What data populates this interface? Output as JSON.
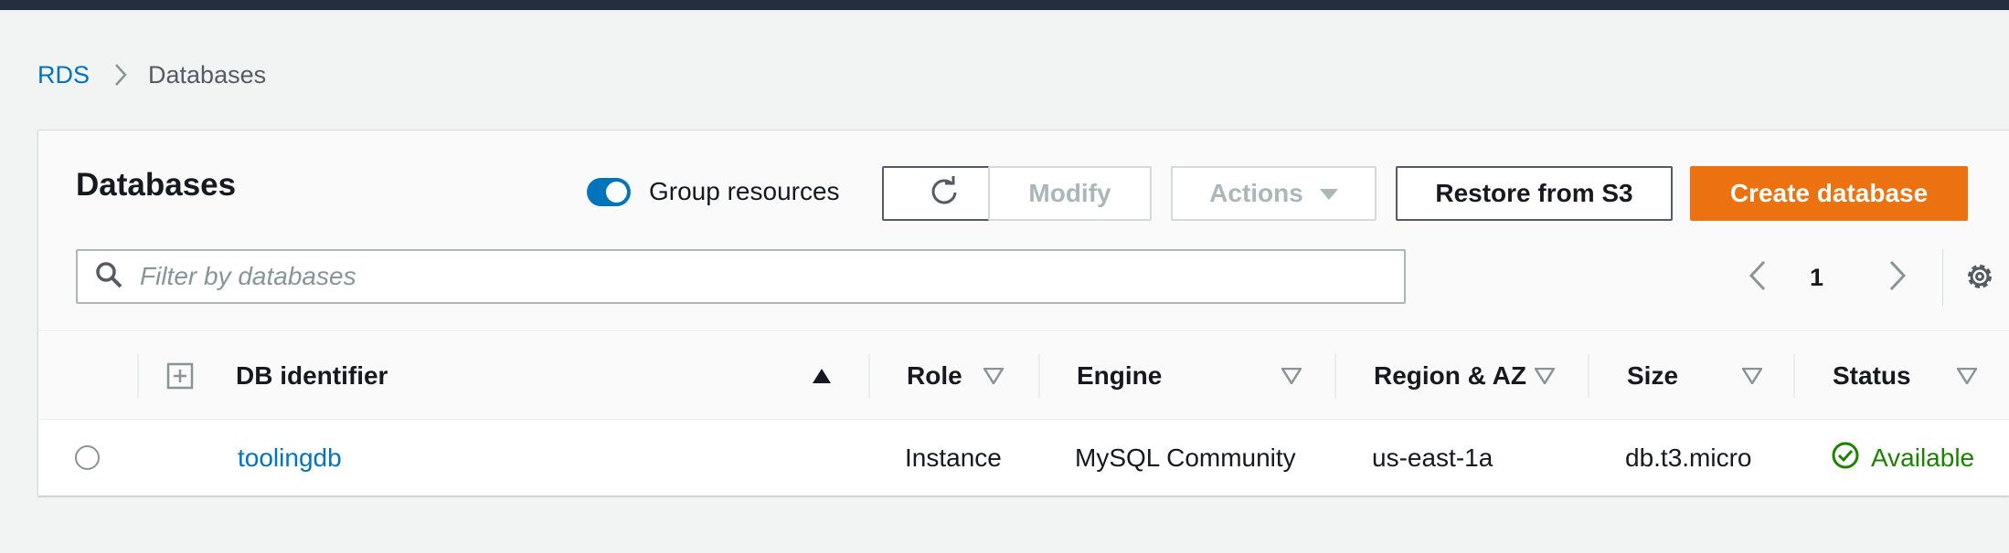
{
  "breadcrumb": {
    "root": "RDS",
    "current": "Databases"
  },
  "panel": {
    "title": "Databases"
  },
  "toolbar": {
    "group_resources_label": "Group resources",
    "group_resources_on": true,
    "modify_label": "Modify",
    "actions_label": "Actions",
    "restore_label": "Restore from S3",
    "create_label": "Create database"
  },
  "search": {
    "placeholder": "Filter by databases",
    "value": ""
  },
  "pagination": {
    "current_page": "1"
  },
  "table": {
    "columns": [
      "DB identifier",
      "Role",
      "Engine",
      "Region & AZ",
      "Size",
      "Status"
    ],
    "rows": [
      {
        "db_identifier": "toolingdb",
        "role": "Instance",
        "engine": "MySQL Community",
        "region_az": "us-east-1a",
        "size": "db.t3.micro",
        "status": "Available"
      }
    ]
  },
  "icons": {
    "refresh": "refresh-icon",
    "search": "search-icon",
    "settings": "gear-icon",
    "prev": "chevron-left-icon",
    "next": "chevron-right-icon",
    "status": "check-circle-icon"
  },
  "colors": {
    "primary": "#ec7211",
    "link": "#0073bb",
    "success": "#1d8102",
    "topbar": "#232f3e"
  }
}
